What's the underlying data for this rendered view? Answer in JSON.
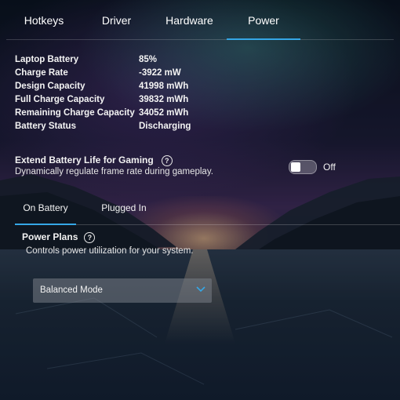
{
  "tabs": [
    "Hotkeys",
    "Driver",
    "Hardware",
    "Power"
  ],
  "battery_info": [
    {
      "label": "Laptop Battery",
      "value": "85%"
    },
    {
      "label": "Charge Rate",
      "value": "-3922 mW"
    },
    {
      "label": "Design Capacity",
      "value": "41998 mWh"
    },
    {
      "label": "Full Charge Capacity",
      "value": "39832 mWh"
    },
    {
      "label": "Remaining Charge Capacity",
      "value": "34052 mWh"
    },
    {
      "label": "Battery Status",
      "value": "Discharging"
    }
  ],
  "extend": {
    "title": "Extend Battery Life for Gaming",
    "description": "Dynamically regulate frame rate during gameplay.",
    "toggle_state": "Off"
  },
  "subtabs": [
    "On Battery",
    "Plugged In"
  ],
  "power_plans": {
    "title": "Power Plans",
    "description": "Controls power utilization for your system.",
    "selected": "Balanced Mode"
  },
  "help_glyph": "?",
  "colors": {
    "accent": "#35a7e6"
  },
  "icons": {
    "help": "help-circle-icon",
    "dropdown": "chevron-down-icon"
  }
}
